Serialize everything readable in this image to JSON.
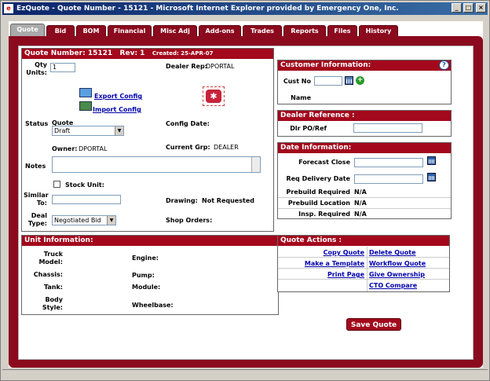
{
  "window": {
    "title": "EzQuote - Quote Number - 15121 - Microsoft Internet Explorer provided by Emergency One, Inc.",
    "min": "_",
    "max": "□",
    "close": "×"
  },
  "tabs": [
    "Quote",
    "Bid",
    "BOM",
    "Financial",
    "Misc Adj",
    "Add-ons",
    "Trades",
    "Reports",
    "Files",
    "History"
  ],
  "quote": {
    "number_label": "Quote Number: 15121",
    "rev_label": "Rev: 1",
    "created_label": "Created: 25-APR-07",
    "qty_label": "Qty Units:",
    "qty_value": "1",
    "dealer_rep_label": "Dealer Rep:",
    "dealer_rep_value": "DPORTAL",
    "export_label": "Export Config",
    "import_label": "Import Config",
    "status_label": "Status",
    "quote_label": "Quote",
    "status_value": "Draft",
    "config_date_label": "Config Date:",
    "owner_label": "Owner:",
    "owner_value": "DPORTAL",
    "current_grp_label": "Current Grp:",
    "current_grp_value": "DEALER",
    "notes_label": "Notes",
    "stock_unit_label": "Stock Unit:",
    "similar_label": "Similar To:",
    "drawing_label": "Drawing:",
    "drawing_value": "Not Requested",
    "deal_type_label": "Deal Type:",
    "deal_type_value": "Negotiated Bid",
    "shop_orders_label": "Shop Orders:"
  },
  "unit": {
    "header": "Unit Information:",
    "truck_model": "Truck Model:",
    "engine": "Engine:",
    "chassis": "Chassis:",
    "pump": "Pump:",
    "tank": "Tank:",
    "module": "Module:",
    "body_style": "Body Style:",
    "wheelbase": "Wheelbase:"
  },
  "customer": {
    "header": "Customer Information:",
    "help": "?",
    "cust_no": "Cust No",
    "name": "Name"
  },
  "dealer_ref": {
    "header": "Dealer Reference :",
    "dlr_po": "Dlr PO/Ref"
  },
  "date_info": {
    "header": "Date Information:",
    "forecast_close": "Forecast Close",
    "req_delivery": "Req Delivery Date",
    "prebuild_required": "Prebuild Required",
    "prebuild_required_value": "N/A",
    "prebuild_location": "Prebuild Location",
    "prebuild_location_value": "N/A",
    "insp_required": "Insp. Required",
    "insp_required_value": "N/A"
  },
  "actions": {
    "header": "Quote Actions :",
    "copy_quote": "Copy Quote",
    "delete_quote": "Delete Quote",
    "make_template": "Make a Template",
    "workflow_quote": "Workflow Quote",
    "print_page": "Print Page",
    "give_ownership": "Give Ownership",
    "cto_compare": "CTO Compare"
  },
  "save_label": "Save Quote"
}
